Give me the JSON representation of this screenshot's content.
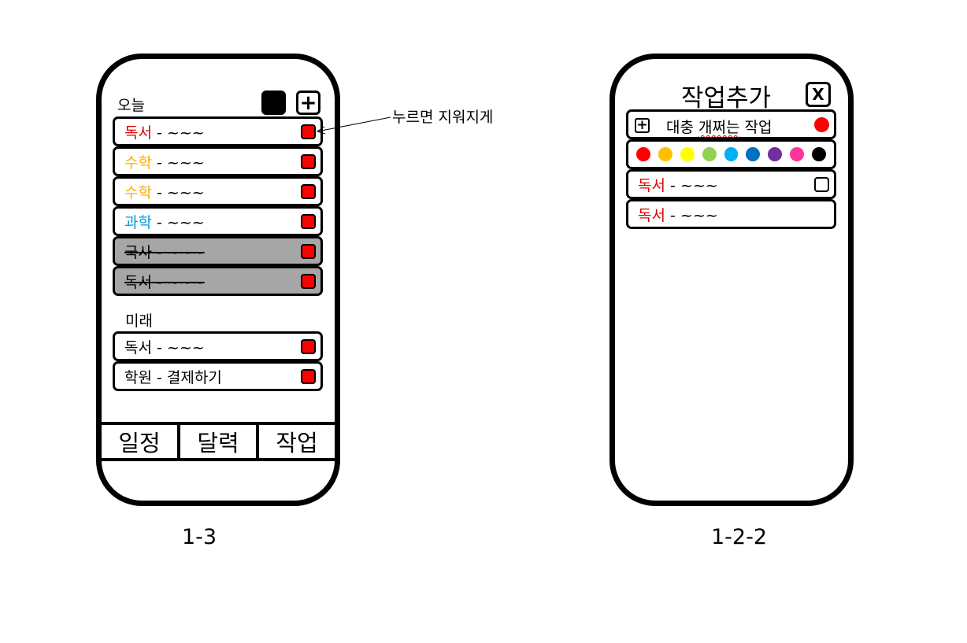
{
  "left_phone": {
    "today_label": "오늘",
    "add_icon": "plus-icon",
    "today_tasks": [
      {
        "subject": "독서",
        "rest": " - ~~~",
        "color": "#e00000",
        "done": false
      },
      {
        "subject": "수학",
        "rest": " - ~~~",
        "color": "#ffb000",
        "done": false
      },
      {
        "subject": "수학",
        "rest": " - ~~~",
        "color": "#ffb000",
        "done": false
      },
      {
        "subject": "과학",
        "rest": " - ~~~",
        "color": "#00a0e0",
        "done": false
      },
      {
        "subject": "국사",
        "rest": " - ~~~",
        "color": "#000000",
        "done": true
      },
      {
        "subject": "독서",
        "rest": " - ~~~",
        "color": "#000000",
        "done": true
      }
    ],
    "future_label": "미래",
    "future_tasks": [
      {
        "subject": "독서",
        "rest": " - ~~~",
        "color": "#000000",
        "done": false
      },
      {
        "subject": "학원",
        "rest": " - 결제하기",
        "color": "#000000",
        "done": false
      }
    ],
    "tabs": [
      "일정",
      "달력",
      "작업"
    ],
    "delete_button_color": "#ff0000"
  },
  "callout": "누르면 지워지게",
  "right_phone": {
    "title": "작업추가",
    "close_label": "X",
    "new_task": {
      "text": "대충 개쩌는 작업",
      "squiggle_part": "개쩌는",
      "color": "#ff0000"
    },
    "palette": [
      "#ff0000",
      "#ffc000",
      "#ffff00",
      "#92d050",
      "#00b0f0",
      "#0070c0",
      "#7030a0",
      "#ff3399",
      "#000000"
    ],
    "items": [
      {
        "subject": "독서",
        "rest": " - ~~~",
        "color": "#e00000",
        "checkbox": true
      },
      {
        "subject": "독서",
        "rest": " - ~~~",
        "color": "#e00000",
        "checkbox": false
      }
    ]
  },
  "captions": {
    "left": "1-3",
    "right": "1-2-2"
  }
}
